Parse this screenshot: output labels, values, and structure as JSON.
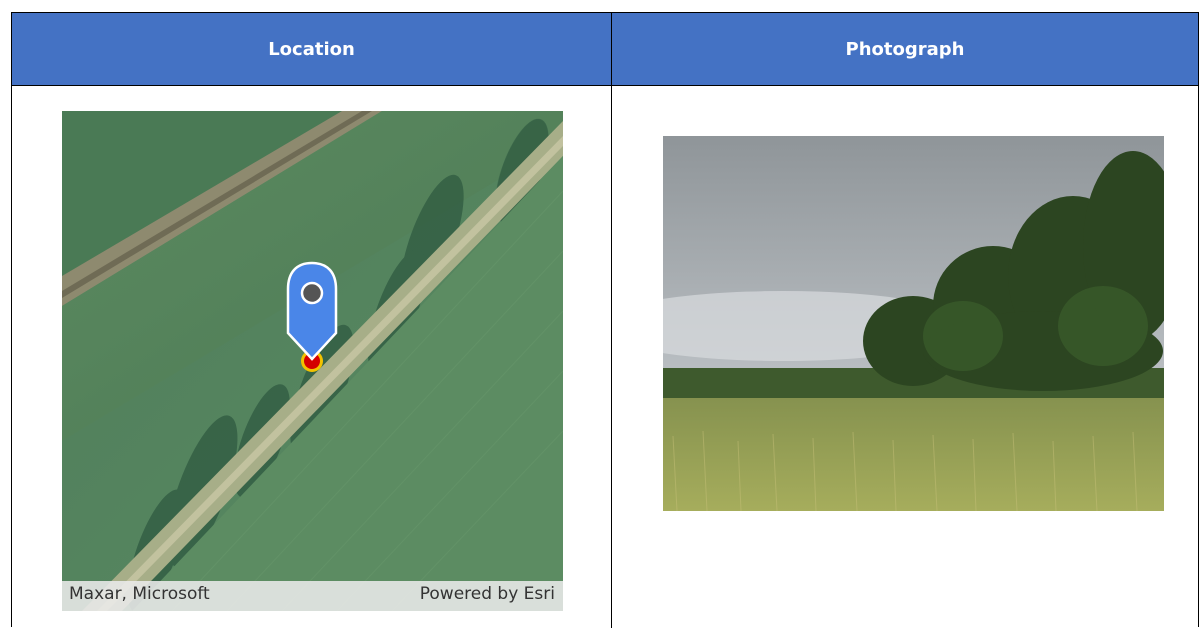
{
  "table": {
    "headers": {
      "location": "Location",
      "photograph": "Photograph"
    },
    "header_color": "#4472c4"
  },
  "map": {
    "attribution_left": "Maxar, Microsoft",
    "attribution_right": "Powered by Esri",
    "marker_icon": "map-pin-icon",
    "marker_color": "#4a86e8"
  },
  "photo": {
    "subject": "wheat field with hedgerow under overcast sky"
  }
}
